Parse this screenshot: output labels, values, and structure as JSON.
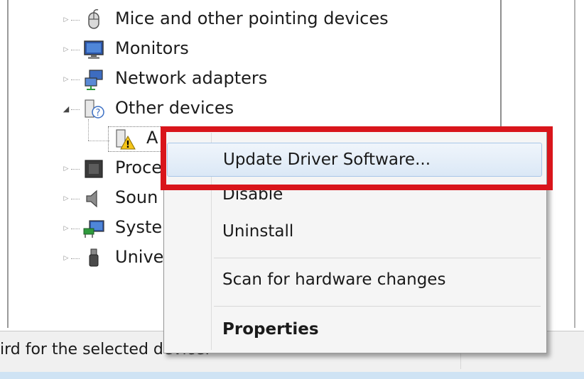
{
  "tree": {
    "items": [
      {
        "label": "Mice and other pointing devices",
        "icon": "mouse-icon",
        "state": "collapsed"
      },
      {
        "label": "Monitors",
        "icon": "monitor-icon",
        "state": "collapsed"
      },
      {
        "label": "Network adapters",
        "icon": "network-adapter-icon",
        "state": "collapsed"
      },
      {
        "label": "Other devices",
        "icon": "other-devices-icon",
        "state": "expanded"
      },
      {
        "label": "A",
        "icon": "unknown-device-warning-icon",
        "state": "child"
      },
      {
        "label": "Proce",
        "icon": "processor-icon",
        "state": "collapsed"
      },
      {
        "label": "Soun",
        "icon": "speaker-icon",
        "state": "collapsed"
      },
      {
        "label": "Syste",
        "icon": "system-devices-icon",
        "state": "collapsed"
      },
      {
        "label": "Unive",
        "icon": "usb-icon",
        "state": "collapsed"
      }
    ]
  },
  "context_menu": {
    "items": [
      {
        "label": "Update Driver Software...",
        "state": "hover"
      },
      {
        "label": "Disable"
      },
      {
        "label": "Uninstall"
      },
      {
        "label": "Scan for hardware changes"
      },
      {
        "label": "Properties",
        "bold": true
      }
    ]
  },
  "status_bar": {
    "text": "ird for the selected device."
  },
  "colors": {
    "highlight": "#d9151b",
    "menu_hover": "#dbe8f6",
    "status_bg": "#f0f0f0"
  }
}
